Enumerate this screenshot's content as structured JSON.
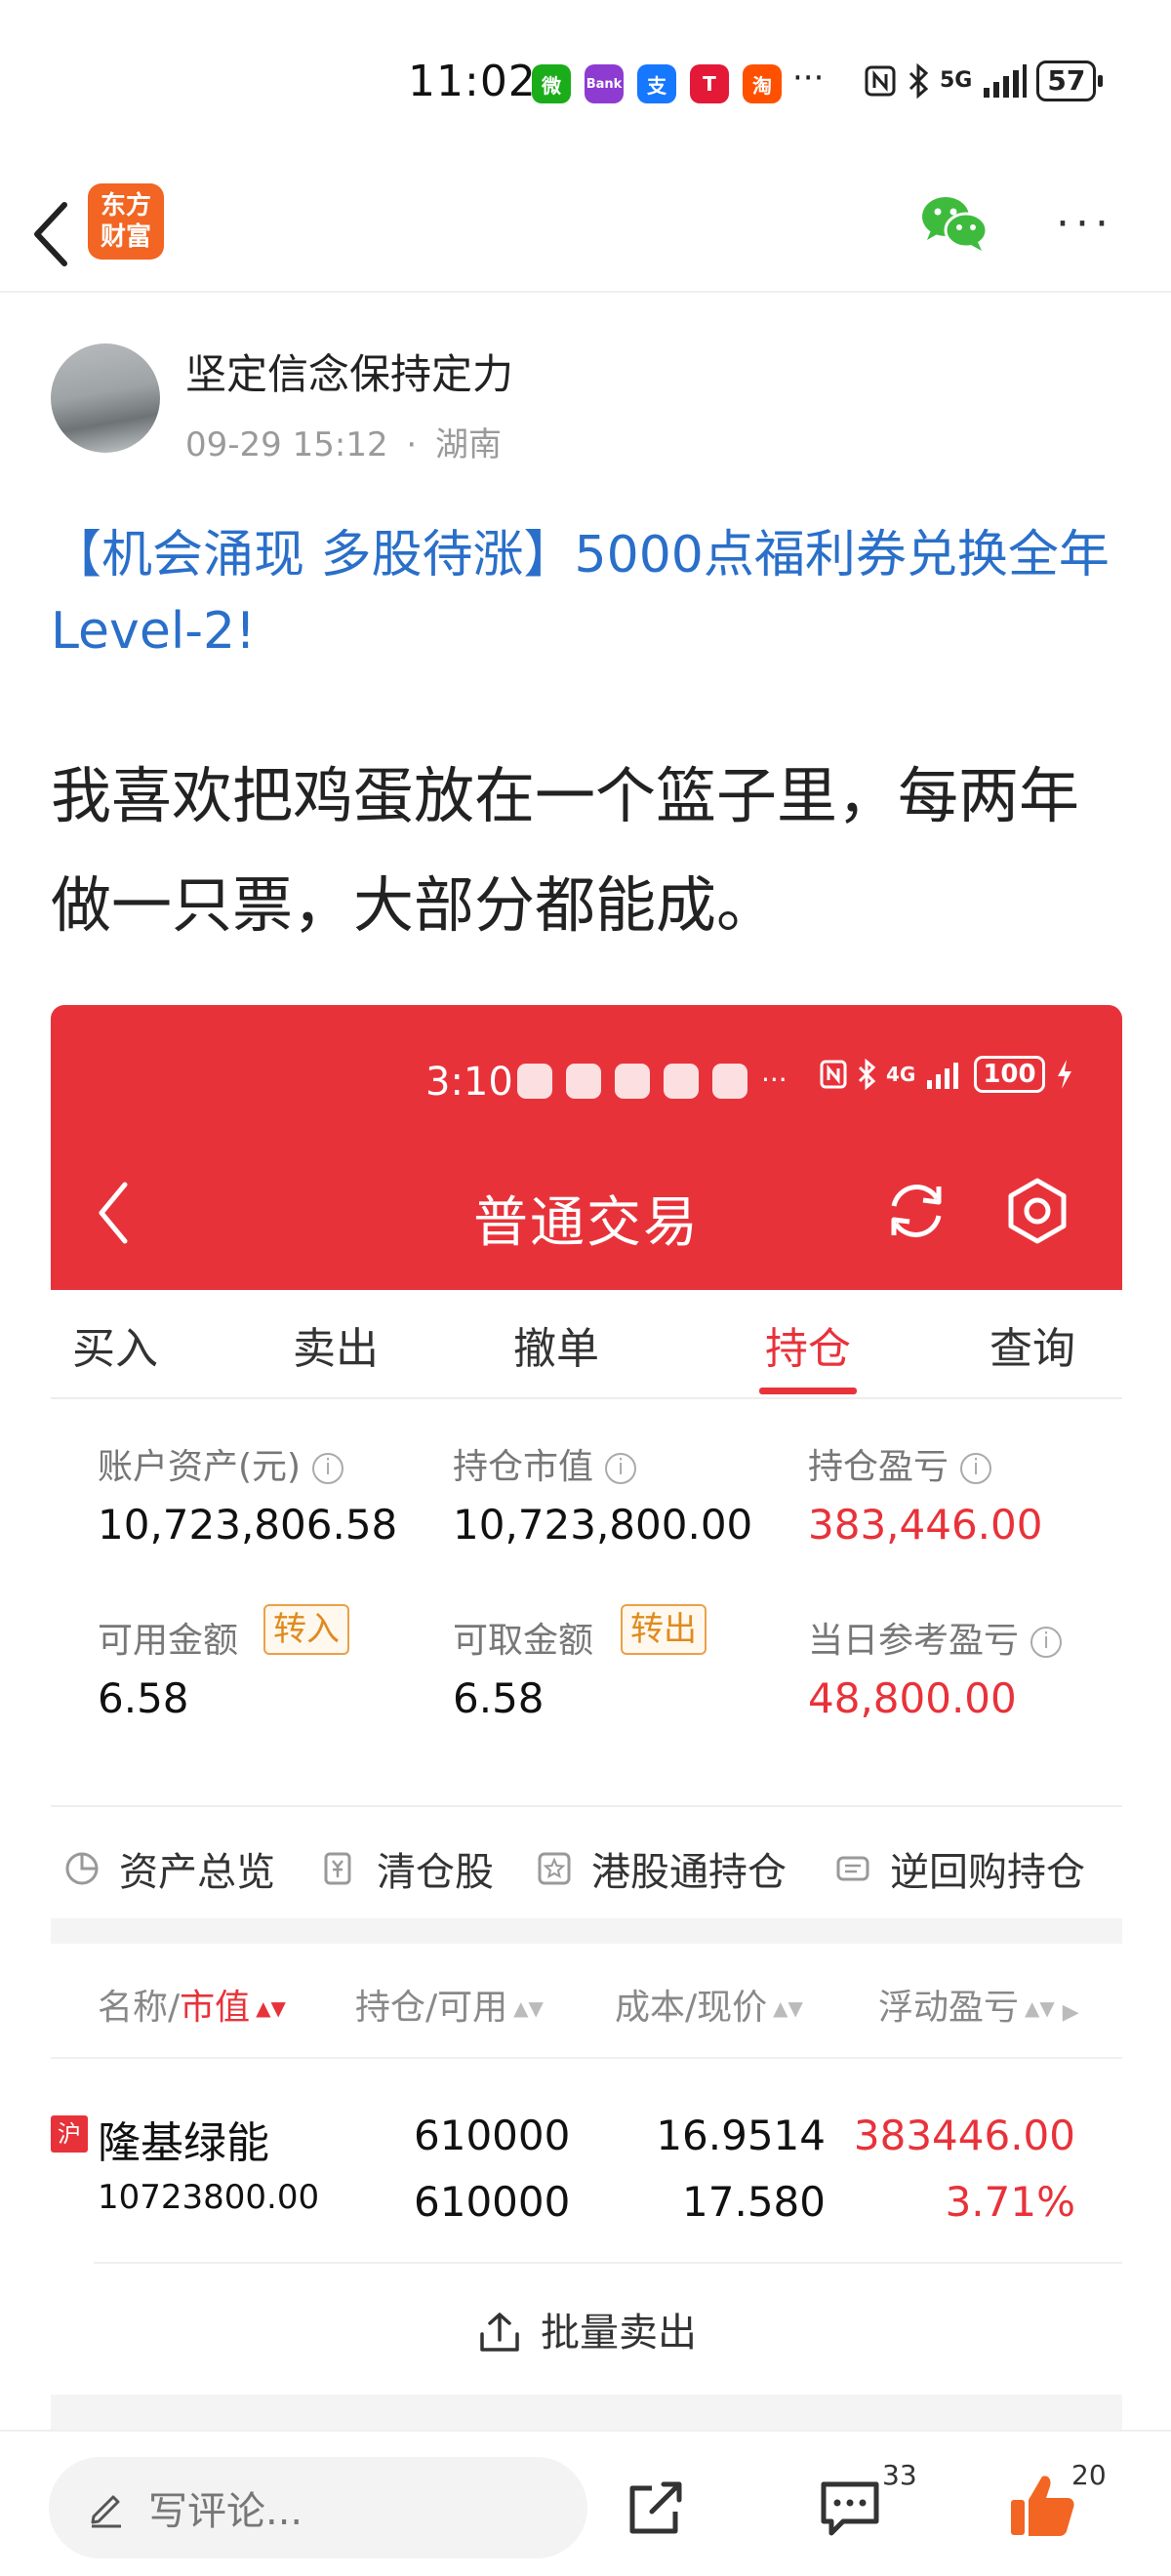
{
  "status_bar": {
    "time": "11:02",
    "notification_apps": [
      {
        "label": "微",
        "color": "#1aad19"
      },
      {
        "label": "Bank",
        "color": "#8e3bd1"
      },
      {
        "label": "支",
        "color": "#1677ff"
      },
      {
        "label": "T",
        "color": "#e31937"
      },
      {
        "label": "淘",
        "color": "#ff5000"
      }
    ],
    "more": "···",
    "network": "5G",
    "battery": "57"
  },
  "nav": {
    "logo_line1": "东方",
    "logo_line2": "财富",
    "more": "···"
  },
  "post": {
    "author": "坚定信念保持定力",
    "date": "09-29 15:12",
    "separator": "·",
    "location": "湖南",
    "title": "【机会涌现 多股待涨】5000点福利券兑换全年Level-2!",
    "body": "我喜欢把鸡蛋放在一个篮子里，每两年做一只票，大部分都能成。"
  },
  "embedded": {
    "status_time": "3:10",
    "status_more": "···",
    "network": "4G",
    "battery": "100",
    "title": "普通交易",
    "tabs": [
      "买入",
      "卖出",
      "撤单",
      "持仓",
      "查询"
    ],
    "active_tab": "持仓",
    "summary": {
      "account_assets_label": "账户资产(元)",
      "account_assets_value": "10,723,806.58",
      "market_value_label": "持仓市值",
      "market_value_value": "10,723,800.00",
      "position_pl_label": "持仓盈亏",
      "position_pl_value": "383,446.00",
      "available_label": "可用金额",
      "available_value": "6.58",
      "transfer_in_label": "转入",
      "withdrawable_label": "可取金额",
      "withdrawable_value": "6.58",
      "transfer_out_label": "转出",
      "daily_pl_label": "当日参考盈亏",
      "daily_pl_value": "48,800.00",
      "info_glyph": "i"
    },
    "quick_links": [
      "资产总览",
      "清仓股",
      "港股通持仓",
      "逆回购持仓"
    ],
    "table_header": {
      "name": "名称/",
      "market_value": "市值",
      "position": "持仓/可用",
      "cost": "成本/现价",
      "float_pl": "浮动盈亏"
    },
    "holding": {
      "exchange": "沪",
      "name": "隆基绿能",
      "market_value": "10723800.00",
      "position": "610000",
      "available": "610000",
      "cost": "16.9514",
      "price": "17.580",
      "float_pl": "383446.00",
      "float_pl_pct": "3.71%"
    },
    "batch_sell": "批量卖出"
  },
  "bottom_bar": {
    "comment_placeholder": "写评论...",
    "comment_count": "33",
    "like_count": "20"
  },
  "colors": {
    "brand_red": "#e8323a",
    "link_blue": "#2a6fc9",
    "orange": "#f26522"
  }
}
